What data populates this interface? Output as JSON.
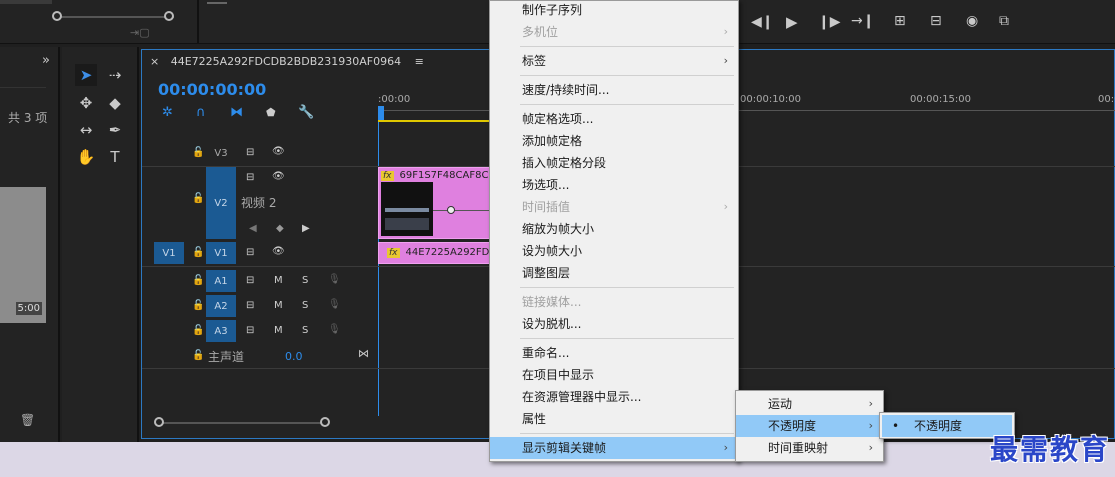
{
  "project_panel": {
    "item_count": "共 3 项",
    "thumb_duration": "5:00"
  },
  "timeline": {
    "sequence_name": "44E7225A292FDCDB2BDB231930AF0964",
    "timecode": "00:00:00:00",
    "ruler_labels": [
      ":00:00",
      "00:00:10:00",
      "00:00:15:00",
      "00:0"
    ],
    "tracks": {
      "v3": "V3",
      "v2": "V2",
      "v2_name": "视频 2",
      "v1_source": "V1",
      "v1": "V1",
      "a1": "A1",
      "a2": "A2",
      "a3": "A3",
      "master_name": "主声道",
      "master_value": "0.0"
    },
    "track_btn_m": "M",
    "track_btn_s": "S",
    "clips": {
      "v2_clip": "69F1S7F48CAF8C16",
      "v1_clip": "44E7225A292FDCDE"
    },
    "fx_label": "fx"
  },
  "context_menu": {
    "items": [
      {
        "label": "制作子序列",
        "disabled": false,
        "submenu": false
      },
      {
        "label": "多机位",
        "disabled": true,
        "submenu": true
      },
      {
        "label": "标签",
        "disabled": false,
        "submenu": true
      },
      {
        "label": "速度/持续时间...",
        "disabled": false,
        "submenu": false
      },
      {
        "label": "帧定格选项...",
        "disabled": false,
        "submenu": false
      },
      {
        "label": "添加帧定格",
        "disabled": false,
        "submenu": false
      },
      {
        "label": "插入帧定格分段",
        "disabled": false,
        "submenu": false
      },
      {
        "label": "场选项...",
        "disabled": false,
        "submenu": false
      },
      {
        "label": "时间插值",
        "disabled": true,
        "submenu": true
      },
      {
        "label": "缩放为帧大小",
        "disabled": false,
        "submenu": false
      },
      {
        "label": "设为帧大小",
        "disabled": false,
        "submenu": false
      },
      {
        "label": "调整图层",
        "disabled": false,
        "submenu": false
      },
      {
        "label": "链接媒体...",
        "disabled": true,
        "submenu": false
      },
      {
        "label": "设为脱机...",
        "disabled": false,
        "submenu": false
      },
      {
        "label": "重命名...",
        "disabled": false,
        "submenu": false
      },
      {
        "label": "在项目中显示",
        "disabled": false,
        "submenu": false
      },
      {
        "label": "在资源管理器中显示...",
        "disabled": false,
        "submenu": false
      },
      {
        "label": "属性",
        "disabled": false,
        "submenu": false
      },
      {
        "label": "显示剪辑关键帧",
        "disabled": false,
        "submenu": true
      }
    ]
  },
  "submenu_keyframes": {
    "items": [
      {
        "label": "运动"
      },
      {
        "label": "不透明度"
      },
      {
        "label": "时间重映射"
      }
    ]
  },
  "submenu_opacity": {
    "checked_item": "不透明度"
  },
  "watermark": "最需教育",
  "icons": {
    "arrow": "›",
    "check": "•",
    "menu": "≡",
    "close": "×",
    "more": "»"
  }
}
